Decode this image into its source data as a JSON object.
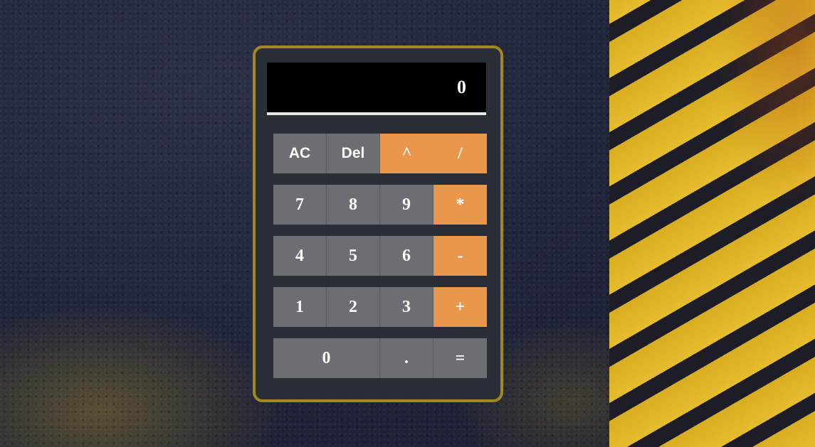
{
  "display": {
    "value": "0"
  },
  "keypad": {
    "rows": [
      [
        "AC",
        "Del",
        "^",
        "/"
      ],
      [
        "7",
        "8",
        "9",
        "*"
      ],
      [
        "4",
        "5",
        "6",
        "-"
      ],
      [
        "1",
        "2",
        "3",
        "+"
      ],
      [
        "0",
        ".",
        "="
      ]
    ]
  },
  "colors": {
    "frame_border": "#a0891f",
    "key_gray": "#6b6e73",
    "key_orange": "#e9974a",
    "display_bg": "#000000"
  }
}
